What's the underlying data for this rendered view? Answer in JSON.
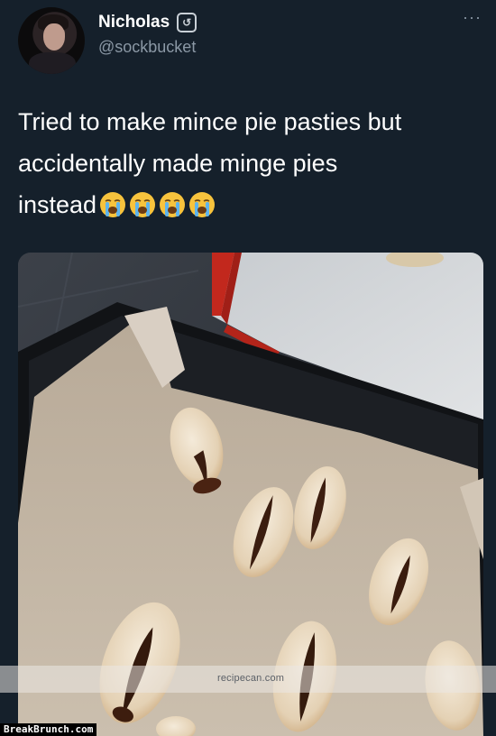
{
  "tweet": {
    "display_name": "Nicholas",
    "badge_icon": "retweet-badge-icon",
    "badge_glyph": "↺",
    "handle": "@sockbucket",
    "more_icon": "more-options-icon",
    "more_glyph": "···",
    "text_line_1": "Tried to make mince pie pasties but",
    "text_line_2": "accidentally made minge pies",
    "text_line_3": "instead",
    "emoji_name": "loudly-crying-face",
    "emoji_count": 4
  },
  "overlay": {
    "watermark": "recipecan.com",
    "site_tag": "BreakBrunch.com"
  },
  "colors": {
    "background": "#15202b",
    "text_primary": "#ffffff",
    "text_secondary": "#8b98a5"
  }
}
